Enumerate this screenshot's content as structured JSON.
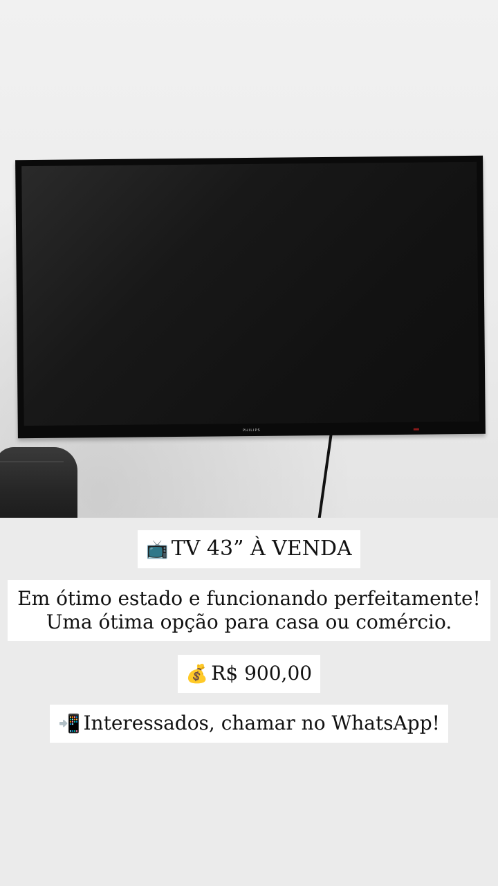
{
  "photo": {
    "brand_text": "PHILIPS"
  },
  "listing": {
    "title_icon": "television-icon",
    "title_emoji": "📺",
    "title": "TV 43” À VENDA",
    "description_line1": "Em ótimo estado e funcionando perfeitamente!",
    "description_line2": "Uma ótima opção para casa ou comércio.",
    "price_icon": "money-bag-icon",
    "price_emoji": "💰",
    "price": "R$ 900,00",
    "contact_icon": "mobile-phone-arrow-icon",
    "contact_emoji": "📲",
    "contact": "Interessados, chamar no WhatsApp!"
  }
}
